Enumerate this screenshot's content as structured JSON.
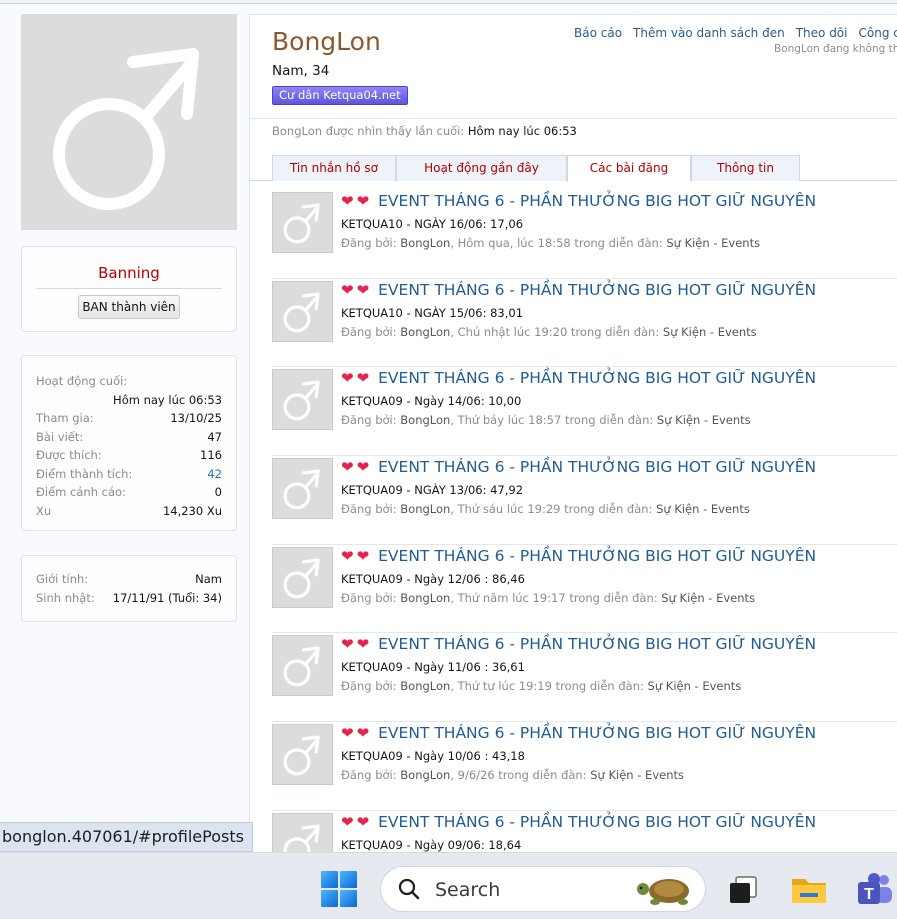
{
  "profile": {
    "name": "BongLon",
    "sub": "Nam, 34",
    "title_badge": "Cư dân Ketqua04.net",
    "actions": [
      "Báo cáo",
      "Thêm vào danh sách đen",
      "Theo dõi",
      "Công cụ qu"
    ],
    "follow_note": "BongLon đang không the",
    "last_seen_label": "BongLon được nhìn thấy lần cuối:",
    "last_seen_value": "Hôm nay lúc 06:53"
  },
  "sidebar": {
    "banning_title": "Banning",
    "ban_button": "BAN thành viên",
    "stats": {
      "last_active_label": "Hoạt động cuối:",
      "last_active_value": "Hôm nay lúc 06:53",
      "rows": [
        {
          "label": "Tham gia:",
          "value": "13/10/25"
        },
        {
          "label": "Bài viết:",
          "value": "47"
        },
        {
          "label": "Được thích:",
          "value": "116"
        },
        {
          "label": "Điểm thành tích:",
          "value": "42"
        },
        {
          "label": "Điểm cảnh cáo:",
          "value": "0"
        },
        {
          "label": "Xu",
          "value": "14,230 Xu"
        }
      ]
    },
    "info": [
      {
        "label": "Giới tính:",
        "value": "Nam"
      },
      {
        "label": "Sinh nhật:",
        "value": "17/11/91 (Tuổi: 34)"
      }
    ]
  },
  "tabs": [
    "Tin nhắn hồ sơ",
    "Hoạt động gần đây",
    "Các bài đăng",
    "Thông tin"
  ],
  "active_tab": "Các bài đăng",
  "posts": [
    {
      "title": "EVENT THÁNG 6 - PHẦN THƯỞNG BIG HOT GIỮ NGUYÊN",
      "snippet": "KETQUA10 - NGÀY 16/06: 17,06",
      "by": "Đăng bởi:",
      "user": "BongLon",
      "when": ", Hôm qua, lúc 18:58 trong diễn đàn:",
      "forum": "Sự Kiện - Events"
    },
    {
      "title": "EVENT THÁNG 6 - PHẦN THƯỞNG BIG HOT GIỮ NGUYÊN",
      "snippet": "KETQUA10 - NGÀY 15/06: 83,01",
      "by": "Đăng bởi:",
      "user": "BongLon",
      "when": ", Chủ nhật lúc 19:20 trong diễn đàn:",
      "forum": "Sự Kiện - Events"
    },
    {
      "title": "EVENT THÁNG 6 - PHẦN THƯỞNG BIG HOT GIỮ NGUYÊN",
      "snippet": "KETQUA09 - Ngày 14/06: 10,00",
      "by": "Đăng bởi:",
      "user": "BongLon",
      "when": ", Thứ bảy lúc 18:57 trong diễn đàn:",
      "forum": "Sự Kiện - Events"
    },
    {
      "title": "EVENT THÁNG 6 - PHẦN THƯỞNG BIG HOT GIỮ NGUYÊN",
      "snippet": "KETQUA09 - NGÀY 13/06: 47,92",
      "by": "Đăng bởi:",
      "user": "BongLon",
      "when": ", Thứ sáu lúc 19:29 trong diễn đàn:",
      "forum": "Sự Kiện - Events"
    },
    {
      "title": "EVENT THÁNG 6 - PHẦN THƯỞNG BIG HOT GIỮ NGUYÊN",
      "snippet": "KETQUA09 - Ngày 12/06 : 86,46",
      "by": "Đăng bởi:",
      "user": "BongLon",
      "when": ", Thứ năm lúc 19:17 trong diễn đàn:",
      "forum": "Sự Kiện - Events"
    },
    {
      "title": "EVENT THÁNG 6 - PHẦN THƯỞNG BIG HOT GIỮ NGUYÊN",
      "snippet": "KETQUA09 - Ngày 11/06 : 36,61",
      "by": "Đăng bởi:",
      "user": "BongLon",
      "when": ", Thứ tư lúc 19:19 trong diễn đàn:",
      "forum": "Sự Kiện - Events"
    },
    {
      "title": "EVENT THÁNG 6 - PHẦN THƯỞNG BIG HOT GIỮ NGUYÊN",
      "snippet": "KETQUA09 - Ngày 10/06 : 43,18",
      "by": "Đăng bởi:",
      "user": "BongLon",
      "when": ", 9/6/26 trong diễn đàn:",
      "forum": "Sự Kiện - Events"
    },
    {
      "title": "EVENT THÁNG 6 - PHẦN THƯỞNG BIG HOT GIỮ NGUYÊN",
      "snippet": "KETQUA09 - Ngày 09/06: 18,64",
      "by": "",
      "user": "",
      "when": "",
      "forum": ""
    }
  ],
  "status_url": "bonglon.407061/#profilePosts",
  "taskbar": {
    "search_placeholder": "Search",
    "icons": [
      "windows-start-icon",
      "search-icon",
      "task-view-icon",
      "file-explorer-icon",
      "teams-icon"
    ]
  },
  "colors": {
    "username": "#8a5a2e",
    "link": "#1f5c94",
    "tab_text": "#b10000",
    "badge": "#6a60e6",
    "heart": "#e3244f"
  }
}
